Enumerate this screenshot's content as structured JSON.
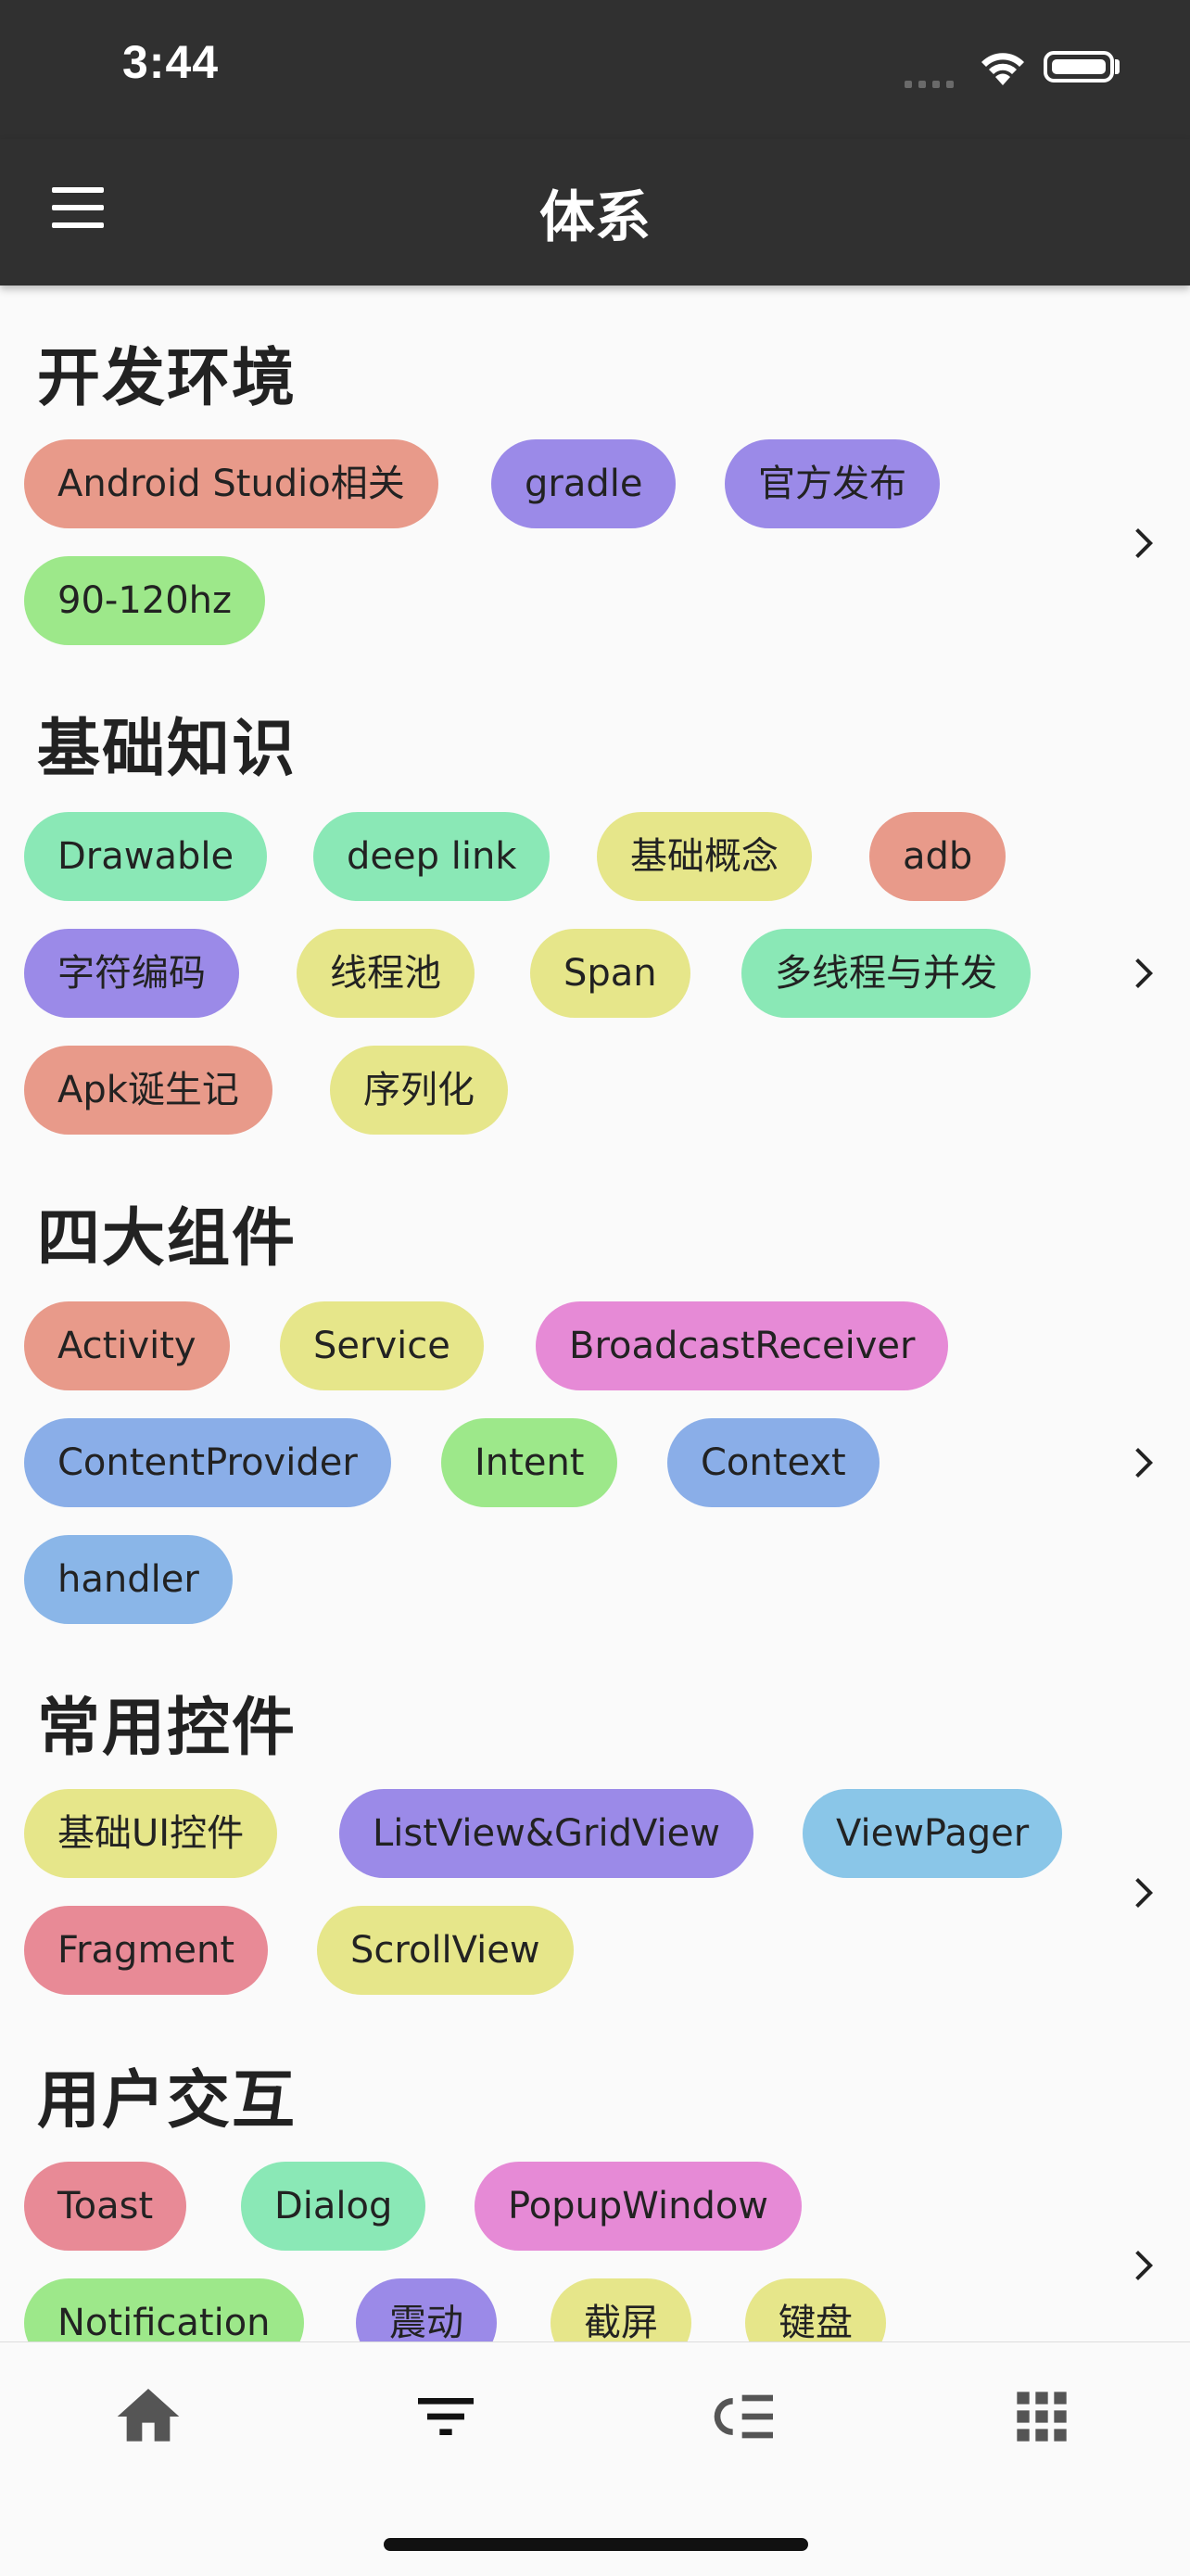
{
  "status": {
    "time": "3:44"
  },
  "app": {
    "title": "体系"
  },
  "sections": [
    {
      "title": "开发环境",
      "chips": [
        "Android Studio相关",
        "gradle",
        "官方发布",
        "90-120hz"
      ]
    },
    {
      "title": "基础知识",
      "chips": [
        "Drawable",
        "deep link",
        "基础概念",
        "adb",
        "字符编码",
        "线程池",
        "Span",
        "多线程与并发",
        "Apk诞生记",
        "序列化"
      ]
    },
    {
      "title": "四大组件",
      "chips": [
        "Activity",
        "Service",
        "BroadcastReceiver",
        "ContentProvider",
        "Intent",
        "Context",
        "handler"
      ]
    },
    {
      "title": "常用控件",
      "chips": [
        "基础UI控件",
        "ListView&GridView",
        "ViewPager",
        "Fragment",
        "ScrollView"
      ]
    },
    {
      "title": "用户交互",
      "chips": [
        "Toast",
        "Dialog",
        "PopupWindow",
        "Notification",
        "震动",
        "截屏",
        "键盘"
      ]
    }
  ],
  "bottom_nav": [
    {
      "icon": "home-icon"
    },
    {
      "icon": "filter-list-icon"
    },
    {
      "icon": "format-list-icon"
    },
    {
      "icon": "apps-grid-icon"
    }
  ],
  "colors": {
    "salmon": "#e89a8a",
    "purple": "#9b8ae8",
    "green": "#9de88a",
    "mint": "#8ae8b6",
    "yellow": "#e6e68a",
    "pink": "#e68ad6",
    "blue": "#8aaee8",
    "sky": "#8ac6e8",
    "rose": "#e88a96"
  }
}
